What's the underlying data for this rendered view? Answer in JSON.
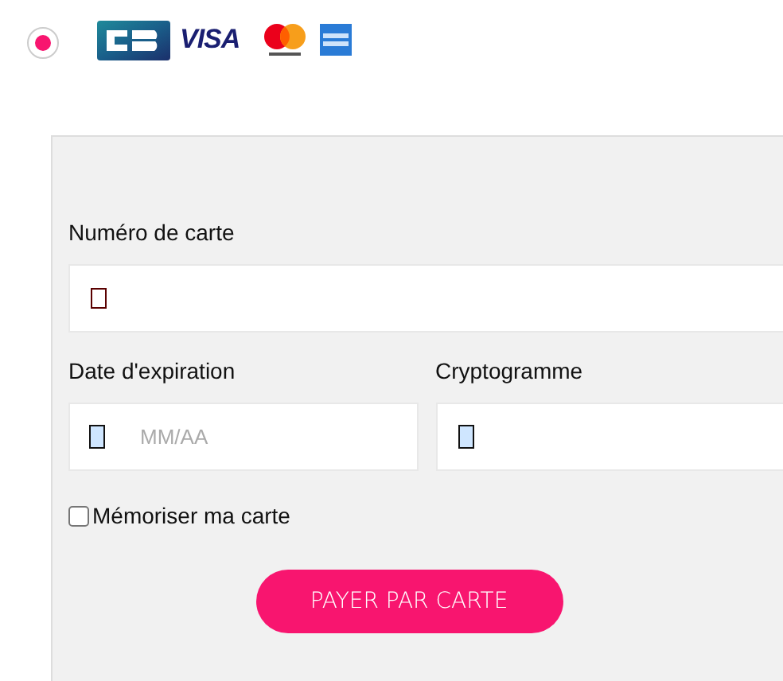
{
  "payment_option": {
    "selected": true,
    "logos": [
      {
        "kind": "cb"
      },
      {
        "kind": "visa",
        "label": "VISA"
      },
      {
        "kind": "mastercard"
      },
      {
        "kind": "amex"
      }
    ]
  },
  "form": {
    "card_number": {
      "label": "Numéro de carte"
    },
    "expiry": {
      "label": "Date d'expiration",
      "placeholder": "MM/AA"
    },
    "cvv": {
      "label": "Cryptogramme"
    },
    "remember": {
      "label": "Mémoriser ma carte",
      "checked": false
    },
    "submit": "PAYER PAR CARTE"
  }
}
